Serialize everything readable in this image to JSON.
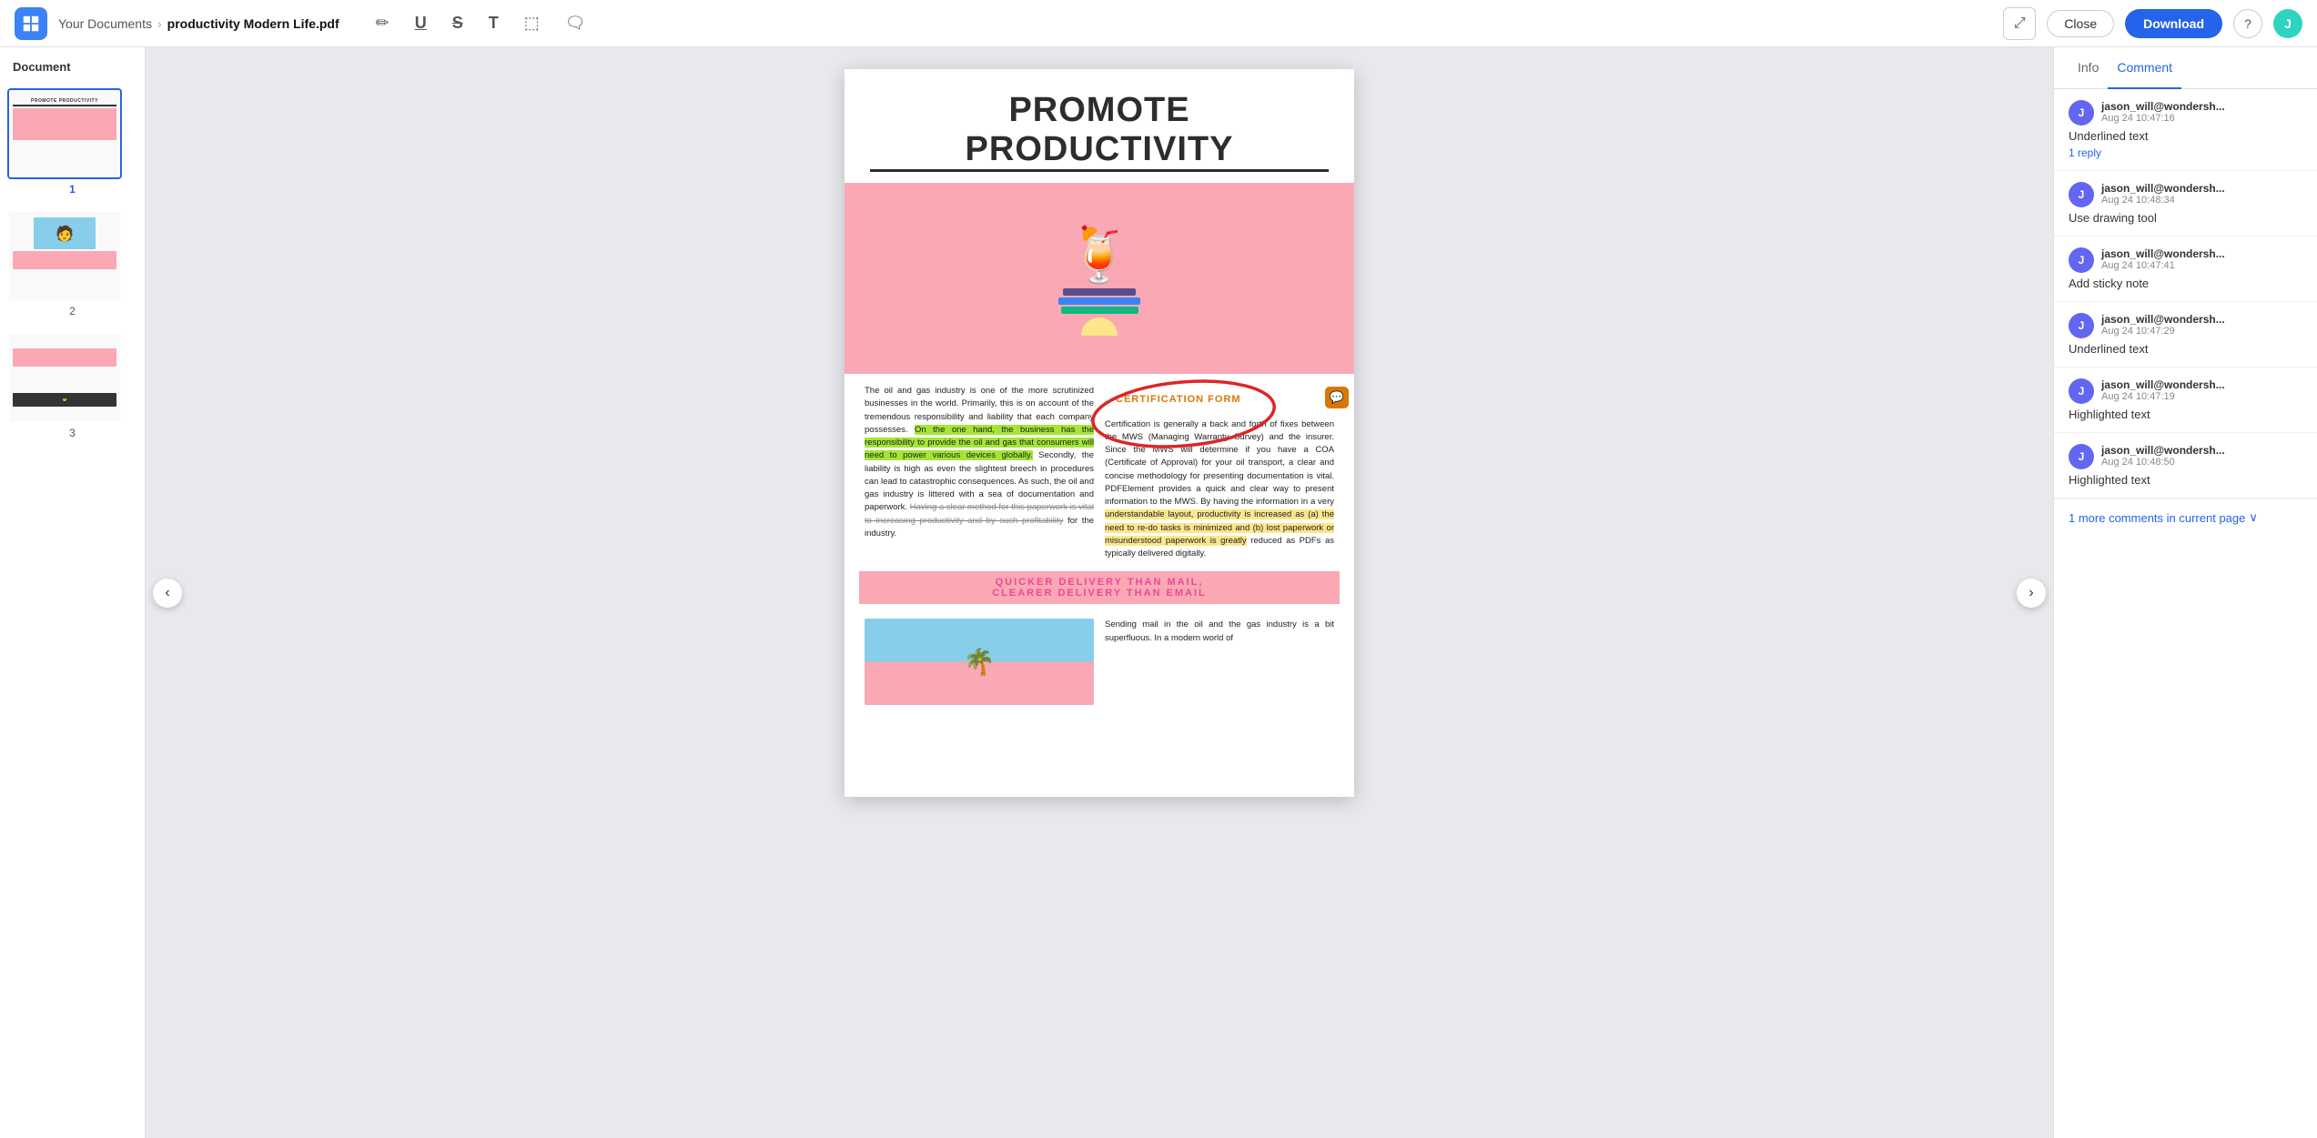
{
  "header": {
    "breadcrumb_root": "Your Documents",
    "filename": "productivity Modern Life.pdf",
    "close_label": "Close",
    "download_label": "Download",
    "avatar_initials": "J",
    "toolbar": {
      "pencil": "✏",
      "underline": "U",
      "strikethrough": "S",
      "text": "T",
      "erase": "◻",
      "comment": "💬"
    }
  },
  "left_sidebar": {
    "title": "Document",
    "pages": [
      {
        "num": "1",
        "active": true
      },
      {
        "num": "2",
        "active": false
      },
      {
        "num": "3",
        "active": false
      }
    ]
  },
  "right_sidebar": {
    "tabs": [
      "Info",
      "Comment"
    ],
    "active_tab": "Comment",
    "comments": [
      {
        "user": "jason_will@wondersh...",
        "time": "Aug 24 10:47:16",
        "text": "Underlined text",
        "reply": "1 reply",
        "avatar": "J"
      },
      {
        "user": "jason_will@wondersh...",
        "time": "Aug 24 10:48:34",
        "text": "Use drawing tool",
        "reply": "",
        "avatar": "J"
      },
      {
        "user": "jason_will@wondersh...",
        "time": "Aug 24 10:47:41",
        "text": "Add sticky note",
        "reply": "",
        "avatar": "J"
      },
      {
        "user": "jason_will@wondersh...",
        "time": "Aug 24 10:47:29",
        "text": "Underlined text",
        "reply": "",
        "avatar": "J"
      },
      {
        "user": "jason_will@wondersh...",
        "time": "Aug 24 10:47:19",
        "text": "Highlighted text",
        "reply": "",
        "avatar": "J"
      },
      {
        "user": "jason_will@wondersh...",
        "time": "Aug 24 10:48:50",
        "text": "Highlighted text",
        "reply": "",
        "avatar": "J"
      }
    ],
    "more_comments": "1 more comments in current page"
  },
  "pdf": {
    "title": "PROMOTE PRODUCTIVITY",
    "col1": {
      "p1": "The oil and gas industry is one of the more scrutinized businesses in the world. Primarily, this is on account of the tremendous responsibility and liability that each company possesses.",
      "p1_highlight": "On the one hand, the business has the responsibility to provide the oil and gas that consumers will need to power various devices globally.",
      "p2": "Secondly, the liability is high as even the slightest breech in procedures can lead to catastrophic consequences. As such, the oil and gas industry is littered with a sea of documentation and paperwork.",
      "p2_strike": "Having a clear method for this paperwork is vital to increasing productivity and by such profitability",
      "p2_end": "for the industry."
    },
    "col2": {
      "cert_title": "CERTIFICATION FORM",
      "cert_body": "Certification is generally a back and forth of fixes between the MWS (Managing Warranty Survey) and the insurer. Since the MWS will determine if you have a COA (Certificate of Approval) for your oil transport, a clear and concise methodology for presenting documentation is vital. PDFElement provides a quick and clear way to present information to the MWS. By having the information in a very",
      "cert_highlight1": "understandable layout, productivity is increased as (a) the need to re-do tasks is minimized and (b) lost paperwork or misunderstood paperwork is greatly",
      "cert_end": "reduced as PDFs as typically delivered digitally."
    },
    "pink_heading1": "QUICKER   DELIVERY   THAN   MAIL,",
    "pink_heading2": "CLEARER DELIVERY THAN EMAIL",
    "bottom_col2": "Sending mail in the oil and the gas industry is a bit superfluous. In a modern world of"
  }
}
